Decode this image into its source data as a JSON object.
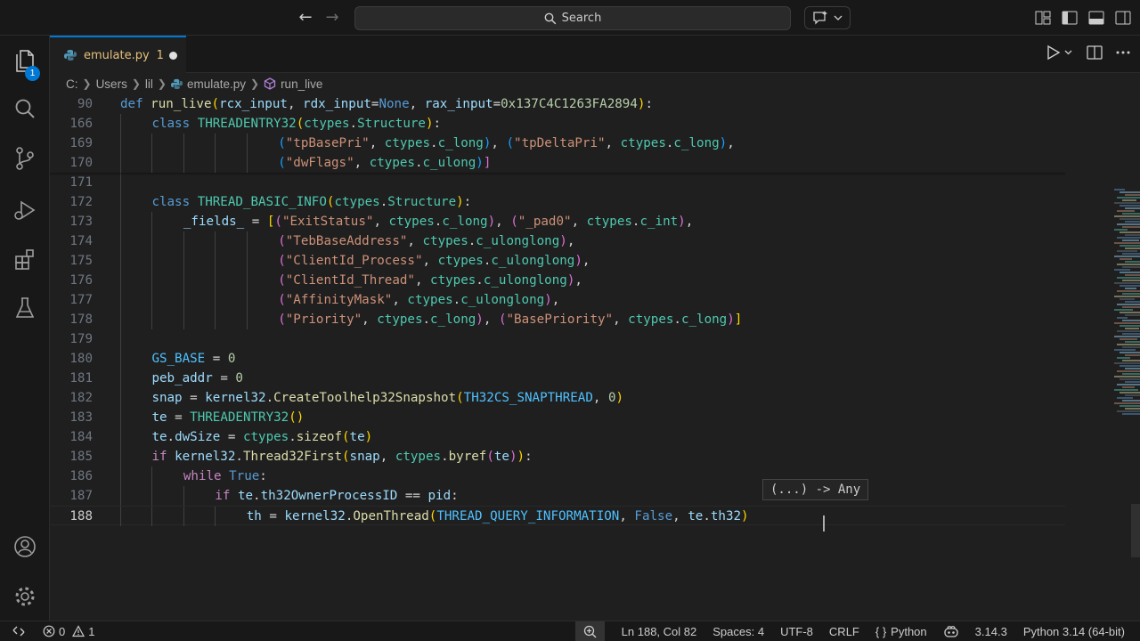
{
  "titlebar": {
    "search_label": "Search",
    "back_icon": "arrow-left-icon",
    "forward_icon": "arrow-right-icon"
  },
  "activity": {
    "explorer_badge": "1"
  },
  "tabs": [
    {
      "label": "emulate.py",
      "problems": "1",
      "dirty": true
    }
  ],
  "breadcrumb": [
    "C:",
    "Users",
    "lil",
    "emulate.py",
    "run_live"
  ],
  "editor": {
    "lines": [
      {
        "n": "90",
        "tokens": [
          [
            "kw",
            "def "
          ],
          [
            "fn",
            "run_live"
          ],
          [
            "br1",
            "("
          ],
          [
            "var",
            "rcx_input"
          ],
          [
            "op",
            ", "
          ],
          [
            "var",
            "rdx_input"
          ],
          [
            "op",
            "="
          ],
          [
            "kw",
            "None"
          ],
          [
            "op",
            ", "
          ],
          [
            "var",
            "rax_input"
          ],
          [
            "op",
            "="
          ],
          [
            "num",
            "0x137C4C1263FA2894"
          ],
          [
            "br1",
            ")"
          ],
          [
            "op",
            ":"
          ]
        ]
      },
      {
        "n": "166",
        "indent": 1,
        "tokens": [
          [
            "kw",
            "class "
          ],
          [
            "cls",
            "THREADENTRY32"
          ],
          [
            "br1",
            "("
          ],
          [
            "cls",
            "ctypes"
          ],
          [
            "op",
            "."
          ],
          [
            "cls",
            "Structure"
          ],
          [
            "br1",
            ")"
          ],
          [
            "op",
            ":"
          ]
        ]
      },
      {
        "n": "169",
        "indent": 5,
        "tokens": [
          [
            "br3",
            "("
          ],
          [
            "str",
            "\"tpBasePri\""
          ],
          [
            "op",
            ", "
          ],
          [
            "cls",
            "ctypes"
          ],
          [
            "op",
            "."
          ],
          [
            "cls",
            "c_long"
          ],
          [
            "br3",
            ")"
          ],
          [
            "op",
            ", "
          ],
          [
            "br3",
            "("
          ],
          [
            "str",
            "\"tpDeltaPri\""
          ],
          [
            "op",
            ", "
          ],
          [
            "cls",
            "ctypes"
          ],
          [
            "op",
            "."
          ],
          [
            "cls",
            "c_long"
          ],
          [
            "br3",
            ")"
          ],
          [
            "op",
            ","
          ]
        ]
      },
      {
        "n": "170",
        "indent": 5,
        "tokens": [
          [
            "br3",
            "("
          ],
          [
            "str",
            "\"dwFlags\""
          ],
          [
            "op",
            ", "
          ],
          [
            "cls",
            "ctypes"
          ],
          [
            "op",
            "."
          ],
          [
            "cls",
            "c_ulong"
          ],
          [
            "br3",
            ")"
          ],
          [
            "br2",
            "]"
          ]
        ]
      },
      {
        "n": "171",
        "indent": 1,
        "tokens": []
      },
      {
        "n": "172",
        "indent": 1,
        "tokens": [
          [
            "kw",
            "class "
          ],
          [
            "cls",
            "THREAD_BASIC_INFO"
          ],
          [
            "br1",
            "("
          ],
          [
            "cls",
            "ctypes"
          ],
          [
            "op",
            "."
          ],
          [
            "cls",
            "Structure"
          ],
          [
            "br1",
            ")"
          ],
          [
            "op",
            ":"
          ]
        ]
      },
      {
        "n": "173",
        "indent": 2,
        "tokens": [
          [
            "var",
            "_fields_"
          ],
          [
            "op",
            " = "
          ],
          [
            "br1",
            "["
          ],
          [
            "br2",
            "("
          ],
          [
            "str",
            "\"ExitStatus\""
          ],
          [
            "op",
            ", "
          ],
          [
            "cls",
            "ctypes"
          ],
          [
            "op",
            "."
          ],
          [
            "cls",
            "c_long"
          ],
          [
            "br2",
            ")"
          ],
          [
            "op",
            ", "
          ],
          [
            "br2",
            "("
          ],
          [
            "str",
            "\"_pad0\""
          ],
          [
            "op",
            ", "
          ],
          [
            "cls",
            "ctypes"
          ],
          [
            "op",
            "."
          ],
          [
            "cls",
            "c_int"
          ],
          [
            "br2",
            ")"
          ],
          [
            "op",
            ","
          ]
        ]
      },
      {
        "n": "174",
        "indent": 5,
        "tokens": [
          [
            "br2",
            "("
          ],
          [
            "str",
            "\"TebBaseAddress\""
          ],
          [
            "op",
            ", "
          ],
          [
            "cls",
            "ctypes"
          ],
          [
            "op",
            "."
          ],
          [
            "cls",
            "c_ulonglong"
          ],
          [
            "br2",
            ")"
          ],
          [
            "op",
            ","
          ]
        ]
      },
      {
        "n": "175",
        "indent": 5,
        "tokens": [
          [
            "br2",
            "("
          ],
          [
            "str",
            "\"ClientId_Process\""
          ],
          [
            "op",
            ", "
          ],
          [
            "cls",
            "ctypes"
          ],
          [
            "op",
            "."
          ],
          [
            "cls",
            "c_ulonglong"
          ],
          [
            "br2",
            ")"
          ],
          [
            "op",
            ","
          ]
        ]
      },
      {
        "n": "176",
        "indent": 5,
        "tokens": [
          [
            "br2",
            "("
          ],
          [
            "str",
            "\"ClientId_Thread\""
          ],
          [
            "op",
            ", "
          ],
          [
            "cls",
            "ctypes"
          ],
          [
            "op",
            "."
          ],
          [
            "cls",
            "c_ulonglong"
          ],
          [
            "br2",
            ")"
          ],
          [
            "op",
            ","
          ]
        ]
      },
      {
        "n": "177",
        "indent": 5,
        "tokens": [
          [
            "br2",
            "("
          ],
          [
            "str",
            "\"AffinityMask\""
          ],
          [
            "op",
            ", "
          ],
          [
            "cls",
            "ctypes"
          ],
          [
            "op",
            "."
          ],
          [
            "cls",
            "c_ulonglong"
          ],
          [
            "br2",
            ")"
          ],
          [
            "op",
            ","
          ]
        ]
      },
      {
        "n": "178",
        "indent": 5,
        "tokens": [
          [
            "br2",
            "("
          ],
          [
            "str",
            "\"Priority\""
          ],
          [
            "op",
            ", "
          ],
          [
            "cls",
            "ctypes"
          ],
          [
            "op",
            "."
          ],
          [
            "cls",
            "c_long"
          ],
          [
            "br2",
            ")"
          ],
          [
            "op",
            ", "
          ],
          [
            "br2",
            "("
          ],
          [
            "str",
            "\"BasePriority\""
          ],
          [
            "op",
            ", "
          ],
          [
            "cls",
            "ctypes"
          ],
          [
            "op",
            "."
          ],
          [
            "cls",
            "c_long"
          ],
          [
            "br2",
            ")"
          ],
          [
            "br1",
            "]"
          ]
        ]
      },
      {
        "n": "179",
        "indent": 1,
        "tokens": []
      },
      {
        "n": "180",
        "indent": 1,
        "tokens": [
          [
            "cst",
            "GS_BASE"
          ],
          [
            "op",
            " = "
          ],
          [
            "num",
            "0"
          ]
        ]
      },
      {
        "n": "181",
        "indent": 1,
        "tokens": [
          [
            "var",
            "peb_addr"
          ],
          [
            "op",
            " = "
          ],
          [
            "num",
            "0"
          ]
        ]
      },
      {
        "n": "182",
        "indent": 1,
        "tokens": [
          [
            "var",
            "snap"
          ],
          [
            "op",
            " = "
          ],
          [
            "var",
            "kernel32"
          ],
          [
            "op",
            "."
          ],
          [
            "fn",
            "CreateToolhelp32Snapshot"
          ],
          [
            "br1",
            "("
          ],
          [
            "cst",
            "TH32CS_SNAPTHREAD"
          ],
          [
            "op",
            ", "
          ],
          [
            "num",
            "0"
          ],
          [
            "br1",
            ")"
          ]
        ]
      },
      {
        "n": "183",
        "indent": 1,
        "tokens": [
          [
            "var",
            "te"
          ],
          [
            "op",
            " = "
          ],
          [
            "cls",
            "THREADENTRY32"
          ],
          [
            "br1",
            "()"
          ]
        ]
      },
      {
        "n": "184",
        "indent": 1,
        "tokens": [
          [
            "var",
            "te"
          ],
          [
            "op",
            "."
          ],
          [
            "var",
            "dwSize"
          ],
          [
            "op",
            " = "
          ],
          [
            "cls",
            "ctypes"
          ],
          [
            "op",
            "."
          ],
          [
            "fn",
            "sizeof"
          ],
          [
            "br1",
            "("
          ],
          [
            "var",
            "te"
          ],
          [
            "br1",
            ")"
          ]
        ]
      },
      {
        "n": "185",
        "indent": 1,
        "tokens": [
          [
            "kwc",
            "if "
          ],
          [
            "var",
            "kernel32"
          ],
          [
            "op",
            "."
          ],
          [
            "fn",
            "Thread32First"
          ],
          [
            "br1",
            "("
          ],
          [
            "var",
            "snap"
          ],
          [
            "op",
            ", "
          ],
          [
            "cls",
            "ctypes"
          ],
          [
            "op",
            "."
          ],
          [
            "fn",
            "byref"
          ],
          [
            "br2",
            "("
          ],
          [
            "var",
            "te"
          ],
          [
            "br2",
            ")"
          ],
          [
            "br1",
            ")"
          ],
          [
            "op",
            ":"
          ]
        ]
      },
      {
        "n": "186",
        "indent": 2,
        "tokens": [
          [
            "kwc",
            "while "
          ],
          [
            "kw",
            "True"
          ],
          [
            "op",
            ":"
          ]
        ]
      },
      {
        "n": "187",
        "indent": 3,
        "tokens": [
          [
            "kwc",
            "if "
          ],
          [
            "var",
            "te"
          ],
          [
            "op",
            "."
          ],
          [
            "var",
            "th32OwnerProcessID"
          ],
          [
            "op",
            " == "
          ],
          [
            "var",
            "pid"
          ],
          [
            "op",
            ":"
          ]
        ]
      },
      {
        "n": "188",
        "indent": 4,
        "active": true,
        "tokens": [
          [
            "var",
            "th"
          ],
          [
            "op",
            " = "
          ],
          [
            "var",
            "kernel32"
          ],
          [
            "op",
            "."
          ],
          [
            "fn",
            "OpenThread"
          ],
          [
            "br1",
            "("
          ],
          [
            "cst",
            "THREAD_QUERY_INFORMATION"
          ],
          [
            "op",
            ", "
          ],
          [
            "kw",
            "False"
          ],
          [
            "op",
            ", "
          ],
          [
            "var",
            "te"
          ],
          [
            "op",
            "."
          ],
          [
            "var",
            "th32"
          ],
          [
            "br1",
            ")"
          ]
        ]
      }
    ],
    "hint_text": "(...) -> Any"
  },
  "status": {
    "errors": "0",
    "warnings": "1",
    "position": "Ln 188, Col 82",
    "spaces": "Spaces: 4",
    "encoding": "UTF-8",
    "eol": "CRLF",
    "language": "Python",
    "python_version": "3.14.3",
    "interpreter": "Python 3.14 (64-bit)"
  },
  "colors": {
    "accent": "#0078d4",
    "background": "#1f1f1f",
    "chrome": "#181818"
  }
}
